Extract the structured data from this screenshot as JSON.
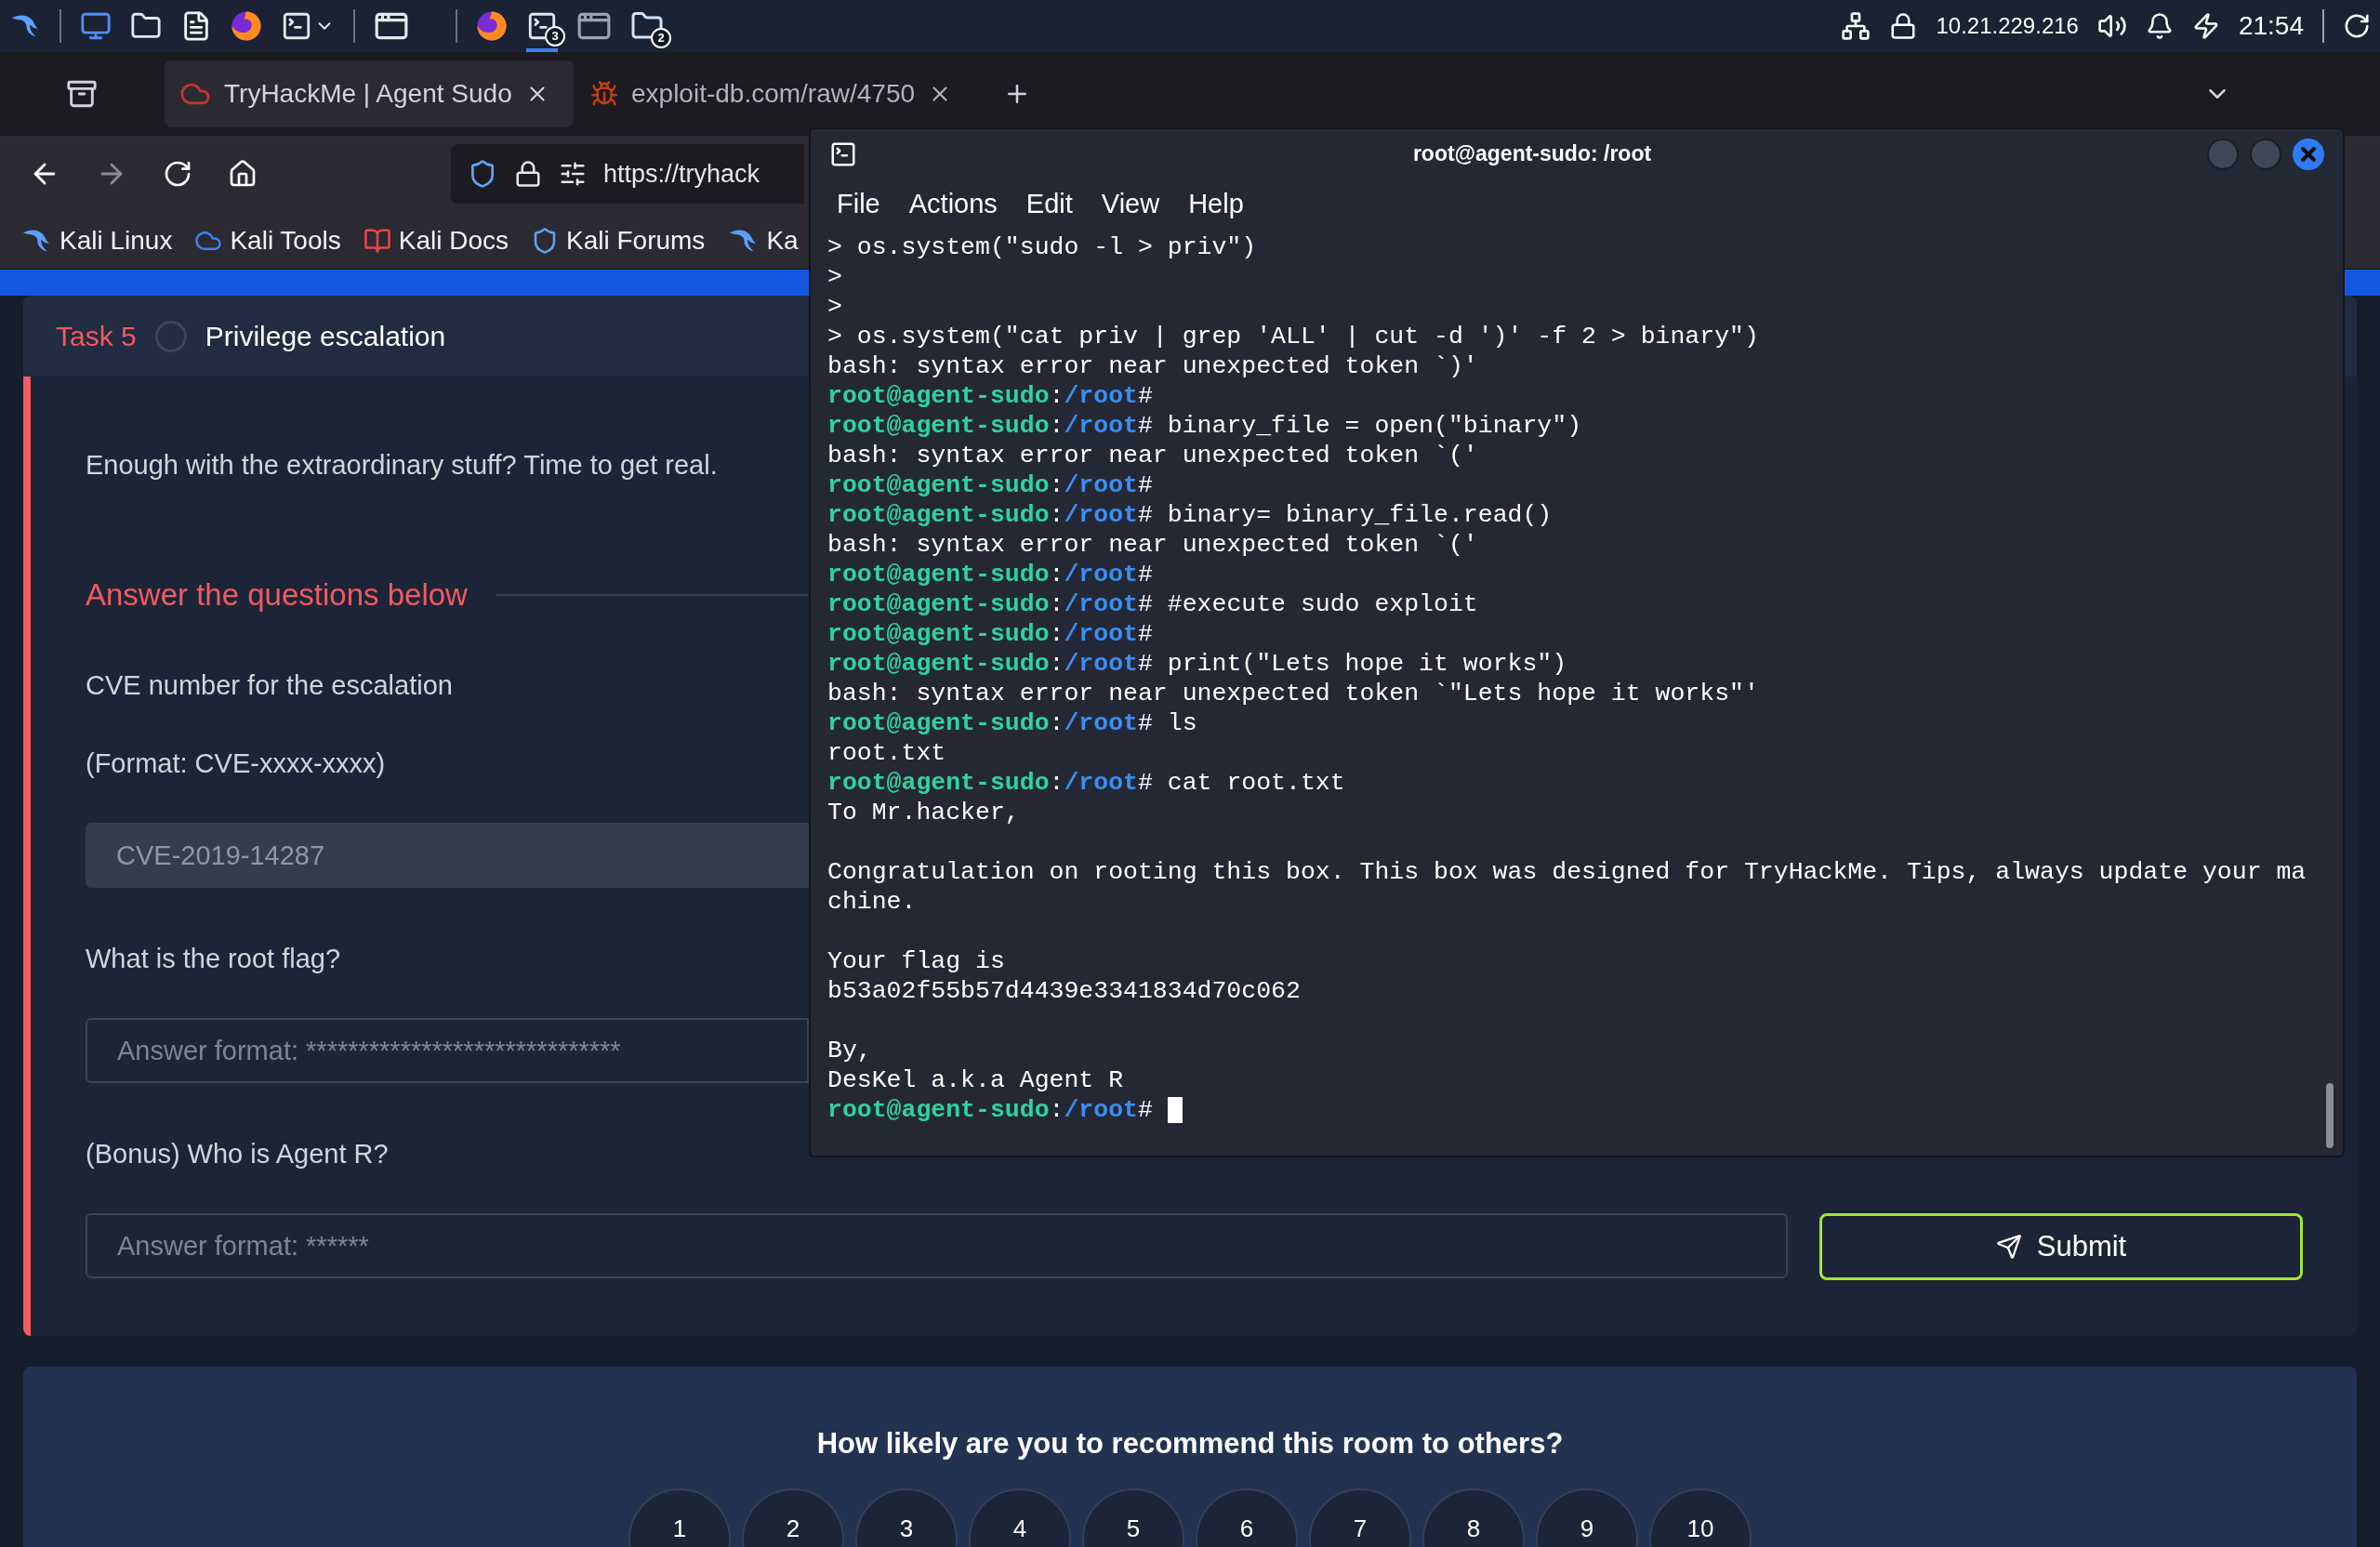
{
  "taskbar": {
    "terminal_badge": "3",
    "files_badge": "2",
    "ip": "10.21.229.216",
    "clock": "21:54"
  },
  "browser": {
    "tabs": [
      {
        "title": "TryHackMe | Agent Sudo",
        "selected": true
      },
      {
        "title": "exploit-db.com/raw/4750",
        "selected": false
      }
    ],
    "url": "https://tryhack",
    "bookmarks": [
      "Kali Linux",
      "Kali Tools",
      "Kali Docs",
      "Kali Forums",
      "Ka"
    ]
  },
  "task": {
    "label": "Task 5",
    "title": "Privilege escalation",
    "completed": false,
    "intro": "Enough with the extraordinary stuff? Time to get real.",
    "section_title": "Answer the questions below",
    "questions": [
      {
        "prompt": "CVE number for the escalation",
        "hint": "(Format: CVE-xxxx-xxxx)",
        "value": "CVE-2019-14287",
        "answered": true
      },
      {
        "prompt": "What is the root flag?",
        "placeholder": "Answer format: ******************************",
        "answered": false
      },
      {
        "prompt": "(Bonus) Who is Agent R?",
        "placeholder": "Answer format: ******",
        "answered": false,
        "submit": "Submit"
      }
    ]
  },
  "rating": {
    "question": "How likely are you to recommend this room to others?",
    "options": [
      "1",
      "2",
      "3",
      "4",
      "5",
      "6",
      "7",
      "8",
      "9",
      "10"
    ]
  },
  "terminal": {
    "title": "root@agent-sudo: /root",
    "menu": [
      "File",
      "Actions",
      "Edit",
      "View",
      "Help"
    ],
    "lines": [
      {
        "kind": "output",
        "text": "> os.system(\"sudo -l > priv\")"
      },
      {
        "kind": "output",
        "text": ">"
      },
      {
        "kind": "output",
        "text": ">"
      },
      {
        "kind": "output",
        "text": "> os.system(\"cat priv | grep 'ALL' | cut -d ')' -f 2 > binary\")"
      },
      {
        "kind": "output",
        "text": "bash: syntax error near unexpected token `)'"
      },
      {
        "kind": "prompt",
        "user": "root@agent-sudo",
        "sep": ":",
        "path": "/root",
        "text": "#"
      },
      {
        "kind": "prompt",
        "user": "root@agent-sudo",
        "sep": ":",
        "path": "/root",
        "text": "# binary_file = open(\"binary\")"
      },
      {
        "kind": "output",
        "text": "bash: syntax error near unexpected token `('"
      },
      {
        "kind": "prompt",
        "user": "root@agent-sudo",
        "sep": ":",
        "path": "/root",
        "text": "#"
      },
      {
        "kind": "prompt",
        "user": "root@agent-sudo",
        "sep": ":",
        "path": "/root",
        "text": "# binary= binary_file.read()"
      },
      {
        "kind": "output",
        "text": "bash: syntax error near unexpected token `('"
      },
      {
        "kind": "prompt",
        "user": "root@agent-sudo",
        "sep": ":",
        "path": "/root",
        "text": "#"
      },
      {
        "kind": "prompt",
        "user": "root@agent-sudo",
        "sep": ":",
        "path": "/root",
        "text": "# #execute sudo exploit"
      },
      {
        "kind": "prompt",
        "user": "root@agent-sudo",
        "sep": ":",
        "path": "/root",
        "text": "#"
      },
      {
        "kind": "prompt",
        "user": "root@agent-sudo",
        "sep": ":",
        "path": "/root",
        "text": "# print(\"Lets hope it works\")"
      },
      {
        "kind": "output",
        "text": "bash: syntax error near unexpected token `\"Lets hope it works\"'"
      },
      {
        "kind": "prompt",
        "user": "root@agent-sudo",
        "sep": ":",
        "path": "/root",
        "text": "# ls"
      },
      {
        "kind": "output",
        "text": "root.txt"
      },
      {
        "kind": "prompt",
        "user": "root@agent-sudo",
        "sep": ":",
        "path": "/root",
        "text": "# cat root.txt"
      },
      {
        "kind": "output",
        "text": "To Mr.hacker,"
      },
      {
        "kind": "blank"
      },
      {
        "kind": "output",
        "text": "Congratulation on rooting this box. This box was designed for TryHackMe. Tips, always update your ma"
      },
      {
        "kind": "output",
        "text": "chine."
      },
      {
        "kind": "blank"
      },
      {
        "kind": "output",
        "text": "Your flag is"
      },
      {
        "kind": "output",
        "text": "b53a02f55b57d4439e3341834d70c062"
      },
      {
        "kind": "blank"
      },
      {
        "kind": "output",
        "text": "By,"
      },
      {
        "kind": "output",
        "text": "DesKel a.k.a Agent R"
      },
      {
        "kind": "prompt",
        "user": "root@agent-sudo",
        "sep": ":",
        "path": "/root",
        "text": "#",
        "cursor": true
      }
    ]
  }
}
